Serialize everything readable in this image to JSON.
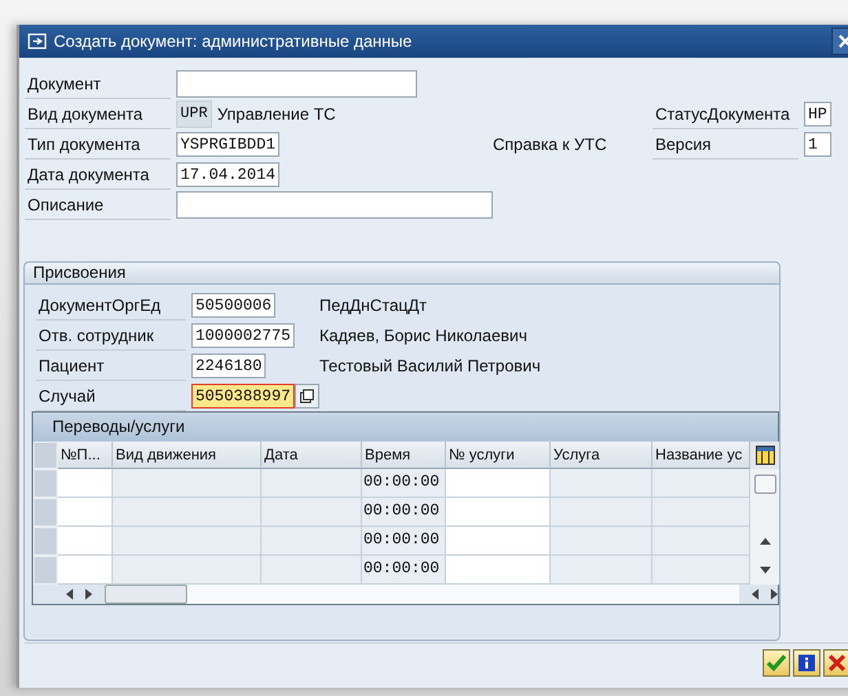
{
  "window": {
    "title": "Создать документ: административные данные"
  },
  "document": {
    "label": "Документ"
  },
  "doc_kind": {
    "label": "Вид документа",
    "code": "UPR",
    "text": "Управление ТС"
  },
  "doc_status": {
    "label": "СтатусДокумента",
    "value": "HP"
  },
  "doc_type": {
    "label": "Тип документа",
    "value": "YSPRGIBDD1",
    "text": "Справка к УТС"
  },
  "version": {
    "label": "Версия",
    "value": "1"
  },
  "doc_date": {
    "label": "Дата документа",
    "value": "17.04.2014"
  },
  "description": {
    "label": "Описание"
  },
  "assignments": {
    "title": "Присвоения",
    "fields": [
      {
        "label": "ДокументОргЕд",
        "value": "50500006",
        "text": "ПедДнСтацДт",
        "focused": false
      },
      {
        "label": "Отв. сотрудник",
        "value": "1000002775",
        "text": "Кадяев, Борис Николаевич",
        "focused": false
      },
      {
        "label": "Пациент",
        "value": "2246180",
        "text": "Тестовый Василий Петрович",
        "focused": false
      },
      {
        "label": "Случай",
        "value": "5050388997",
        "focused": true
      }
    ]
  },
  "table": {
    "title": "Переводы/услуги",
    "columns": [
      {
        "label": "№П...",
        "editable": true
      },
      {
        "label": "Вид движения",
        "editable": false
      },
      {
        "label": "Дата",
        "editable": false
      },
      {
        "label": "Время",
        "editable": false
      },
      {
        "label": "№ услуги",
        "editable": true
      },
      {
        "label": "Услуга",
        "editable": false
      },
      {
        "label": "Название ус",
        "editable": false
      }
    ],
    "rows": [
      {
        "time": "00:00:00"
      },
      {
        "time": "00:00:00"
      },
      {
        "time": "00:00:00"
      },
      {
        "time": "00:00:00"
      }
    ]
  },
  "buttons": [
    {
      "kind": "confirm"
    },
    {
      "kind": "info"
    },
    {
      "kind": "cancel"
    }
  ]
}
